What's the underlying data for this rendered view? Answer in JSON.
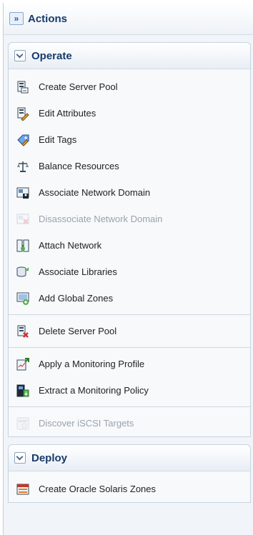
{
  "actions": {
    "title": "Actions",
    "expand_glyph": "»"
  },
  "operate": {
    "title": "Operate",
    "groups": [
      [
        {
          "label": "Create Server Pool",
          "icon": "server-pool-create-icon",
          "enabled": true
        },
        {
          "label": "Edit Attributes",
          "icon": "edit-attributes-icon",
          "enabled": true
        },
        {
          "label": "Edit Tags",
          "icon": "edit-tags-icon",
          "enabled": true
        },
        {
          "label": "Balance Resources",
          "icon": "balance-resources-icon",
          "enabled": true
        },
        {
          "label": "Associate Network Domain",
          "icon": "associate-network-domain-icon",
          "enabled": true
        },
        {
          "label": "Disassociate Network Domain",
          "icon": "disassociate-network-domain-icon",
          "enabled": false
        },
        {
          "label": "Attach Network",
          "icon": "attach-network-icon",
          "enabled": true
        },
        {
          "label": "Associate Libraries",
          "icon": "associate-libraries-icon",
          "enabled": true
        },
        {
          "label": "Add Global Zones",
          "icon": "add-global-zones-icon",
          "enabled": true
        }
      ],
      [
        {
          "label": "Delete Server Pool",
          "icon": "delete-server-pool-icon",
          "enabled": true
        }
      ],
      [
        {
          "label": "Apply a Monitoring Profile",
          "icon": "apply-monitoring-profile-icon",
          "enabled": true
        },
        {
          "label": "Extract a Monitoring Policy",
          "icon": "extract-monitoring-policy-icon",
          "enabled": true
        }
      ],
      [
        {
          "label": "Discover iSCSI Targets",
          "icon": "discover-iscsi-icon",
          "enabled": false
        }
      ]
    ]
  },
  "deploy": {
    "title": "Deploy",
    "items": [
      {
        "label": "Create Oracle Solaris Zones",
        "icon": "solaris-zones-icon",
        "enabled": true
      }
    ]
  }
}
